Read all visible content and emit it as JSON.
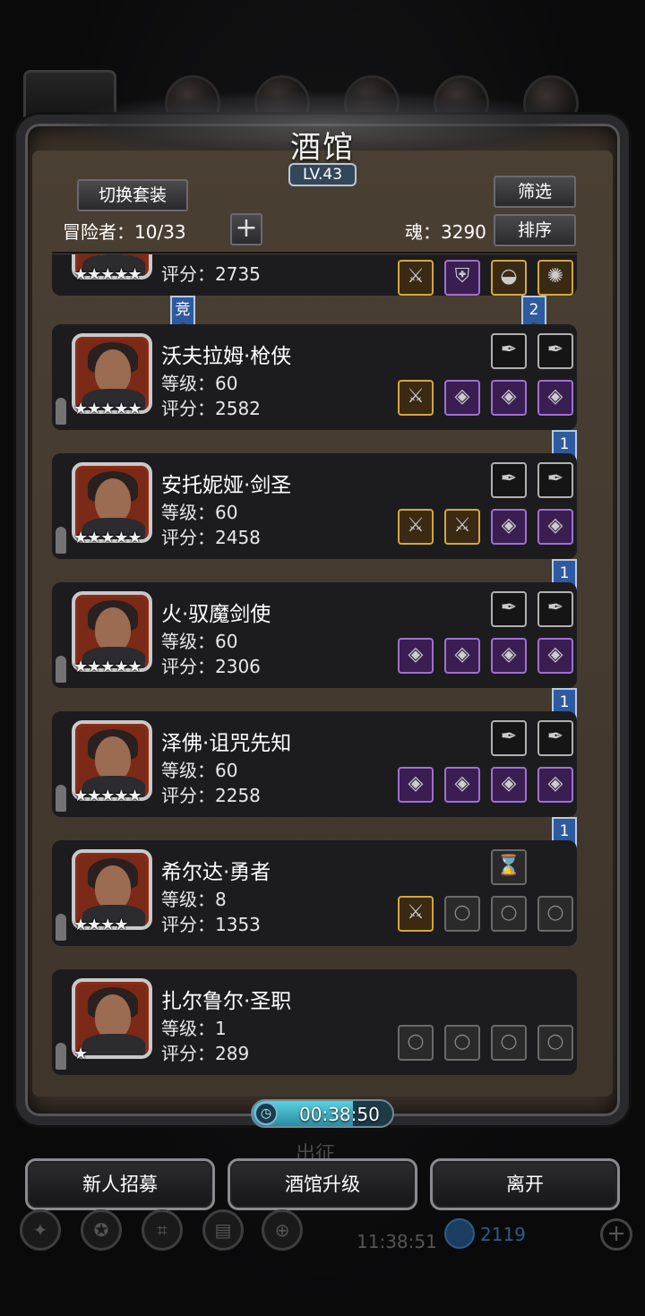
{
  "header": {
    "title": "酒馆",
    "level": "LV.43",
    "switch_outfit": "切换套装",
    "filter": "筛选",
    "sort": "排序",
    "adventurers_label": "冒险者：10/33",
    "plus": "+",
    "soul_label": "魂：3290"
  },
  "top_card": {
    "score": "评分：2735",
    "stars": "★★★★★",
    "ribbon_left": "竞",
    "ribbon_right": "2"
  },
  "heroes": [
    {
      "name": "沃夫拉姆·枪侠",
      "level": "等级：60",
      "score": "评分：2582",
      "stars": "★★★★★",
      "ribbon": "1",
      "top_slots": [
        "plain",
        "plain"
      ],
      "bottom_slots": [
        "gold",
        "purple",
        "purple",
        "purple"
      ]
    },
    {
      "name": "安托妮娅·剑圣",
      "level": "等级：60",
      "score": "评分：2458",
      "stars": "★★★★★",
      "ribbon": "1",
      "top_slots": [
        "plain",
        "plain"
      ],
      "bottom_slots": [
        "gold",
        "gold",
        "purple",
        "purple"
      ]
    },
    {
      "name": "火·驭魔剑使",
      "level": "等级：60",
      "score": "评分：2306",
      "stars": "★★★★★",
      "ribbon": "1",
      "top_slots": [
        "plain",
        "plain"
      ],
      "bottom_slots": [
        "purple",
        "purple",
        "purple",
        "purple"
      ]
    },
    {
      "name": "泽佛·诅咒先知",
      "level": "等级：60",
      "score": "评分：2258",
      "stars": "★★★★★",
      "ribbon": "1",
      "top_slots": [
        "plain",
        "plain"
      ],
      "bottom_slots": [
        "purple",
        "purple",
        "purple",
        "purple"
      ]
    },
    {
      "name": "希尔达·勇者",
      "level": "等级：8",
      "score": "评分：1353",
      "stars": "★★★★",
      "top_slots": [
        "empty"
      ],
      "bottom_slots": [
        "gold",
        "empty",
        "empty",
        "empty"
      ]
    },
    {
      "name": "扎尔鲁尔·圣职",
      "level": "等级：1",
      "score": "评分：289",
      "stars": "★",
      "top_slots": [],
      "bottom_slots": [
        "empty",
        "empty",
        "empty",
        "empty"
      ]
    }
  ],
  "timer": {
    "time": "00:38:50",
    "progress": 0.72
  },
  "ghost_text": "出征",
  "buttons": {
    "recruit": "新人招募",
    "upgrade": "酒馆升级",
    "leave": "离开"
  },
  "dock": {
    "clock": "11:38:51",
    "gems": "2119",
    "plus": "+"
  },
  "colors": {
    "ribbon": "#2e5aa0",
    "gold_slot": "#d4a83a",
    "purple_slot": "#a070d0"
  }
}
